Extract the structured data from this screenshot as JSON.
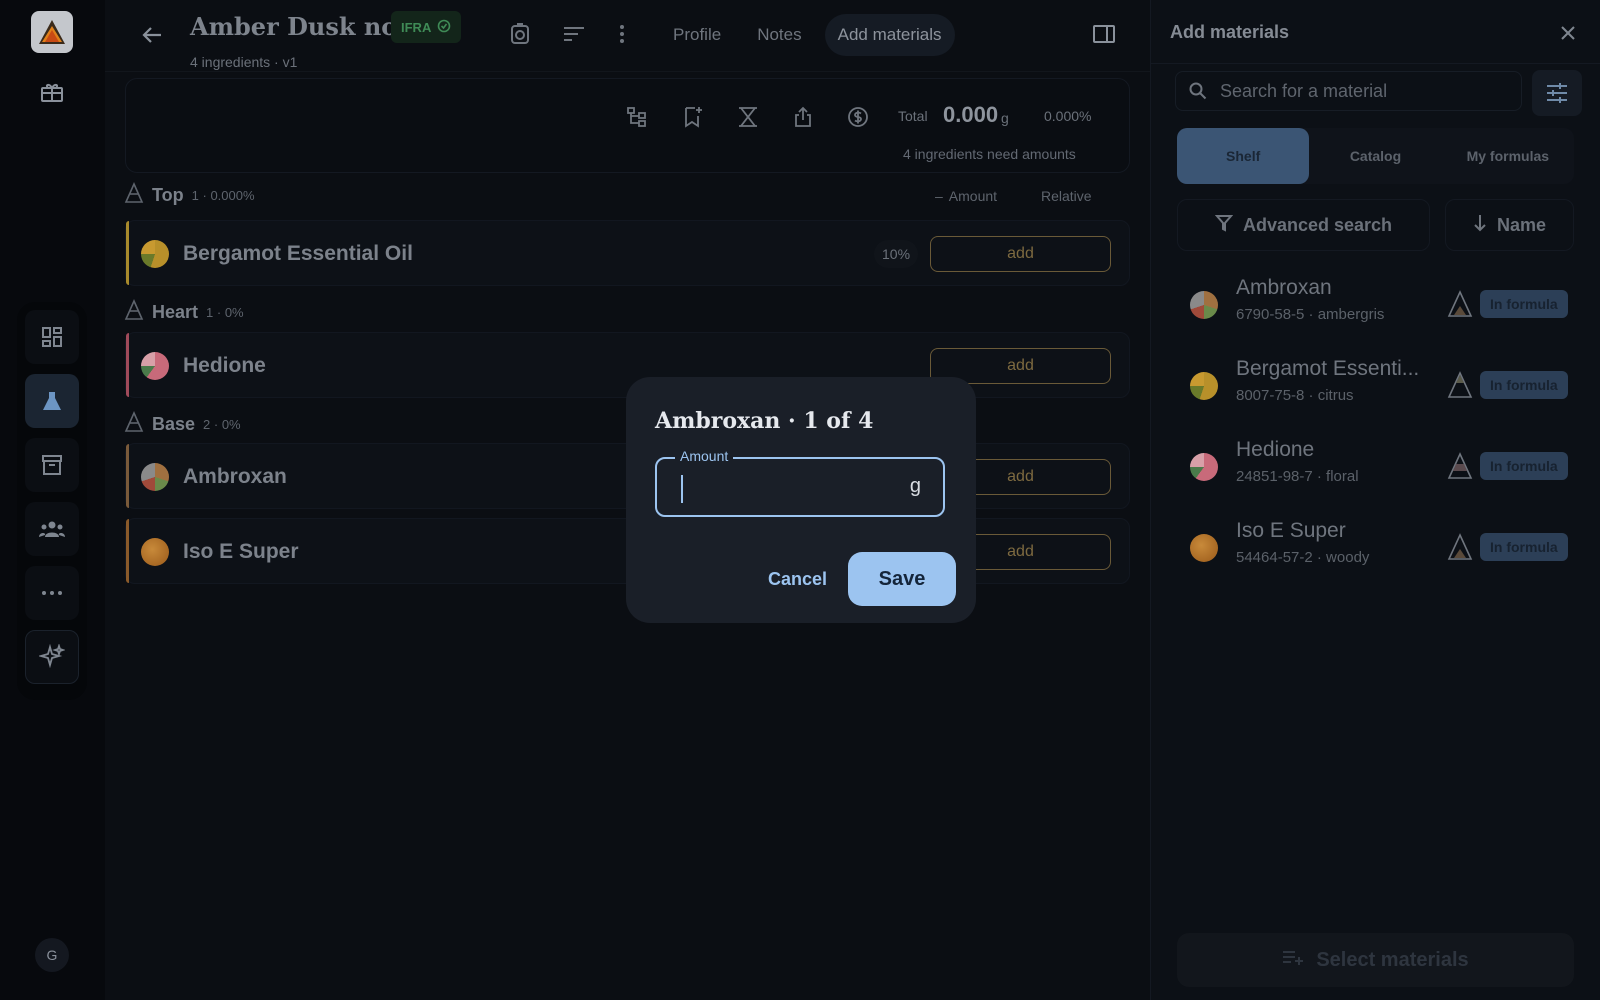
{
  "header": {
    "title": "Amber Dusk no. 1",
    "subtitle": "4 ingredients · v1",
    "ifra_badge": "IFRA",
    "tabs": [
      {
        "label": "Profile",
        "active": false
      },
      {
        "label": "Notes",
        "active": false
      },
      {
        "label": "Add materials",
        "active": true
      }
    ]
  },
  "summary": {
    "total_label": "Total",
    "total_value": "0.000",
    "total_unit": "g",
    "total_pct": "0.000%",
    "need_amounts": "4 ingredients need amounts"
  },
  "columns": {
    "amount": "Amount",
    "relative": "Relative"
  },
  "sections": [
    {
      "name": "Top",
      "meta": "1 · 0.000%"
    },
    {
      "name": "Heart",
      "meta": "1 · 0%"
    },
    {
      "name": "Base",
      "meta": "2 · 0%"
    }
  ],
  "ingredients": [
    {
      "name": "Bergamot Essential Oil",
      "pct": "10%",
      "add_label": "add",
      "accent": "#a88a2c"
    },
    {
      "name": "Hedione",
      "add_label": "add",
      "accent": "#a04a5a"
    },
    {
      "name": "Ambroxan",
      "add_label": "add",
      "accent": "#7a5a3a"
    },
    {
      "name": "Iso E Super",
      "add_label": "add",
      "accent": "#8a5a2a"
    }
  ],
  "right_panel": {
    "title": "Add materials",
    "search_placeholder": "Search for a material",
    "segments": [
      "Shelf",
      "Catalog",
      "My formulas"
    ],
    "active_segment": "Shelf",
    "advanced_search": "Advanced search",
    "sort_label": "Name",
    "materials": [
      {
        "name": "Ambroxan",
        "meta": "6790-58-5 · ambergris",
        "badge": "In formula"
      },
      {
        "name": "Bergamot Essenti...",
        "meta": "8007-75-8 · citrus",
        "badge": "In formula"
      },
      {
        "name": "Hedione",
        "meta": "24851-98-7 · floral",
        "badge": "In formula"
      },
      {
        "name": "Iso E Super",
        "meta": "54464-57-2 · woody",
        "badge": "In formula"
      }
    ],
    "select_button": "Select materials"
  },
  "modal": {
    "title": "Ambroxan · 1 of 4",
    "field_label": "Amount",
    "field_value": "",
    "unit": "g",
    "cancel": "Cancel",
    "save": "Save"
  },
  "user": {
    "initial": "G"
  },
  "colors": {
    "accent_blue": "#9cc4f0",
    "add_gold": "#7d6a40",
    "ifra_green": "#3f8a56"
  },
  "icons": [
    "app-logo-icon",
    "gift-icon",
    "dashboard-icon",
    "flask-icon",
    "archive-icon",
    "team-icon",
    "more-icon",
    "sparkle-icon",
    "back-arrow-icon",
    "check-circle-icon",
    "timer-icon",
    "sort-icon",
    "kebab-icon",
    "panel-icon",
    "hierarchy-icon",
    "bookmark-add-icon",
    "hourglass-icon",
    "share-icon",
    "dollar-icon",
    "search-icon",
    "sliders-icon",
    "filter-icon",
    "arrow-down-icon",
    "close-icon",
    "playlist-add-icon"
  ]
}
